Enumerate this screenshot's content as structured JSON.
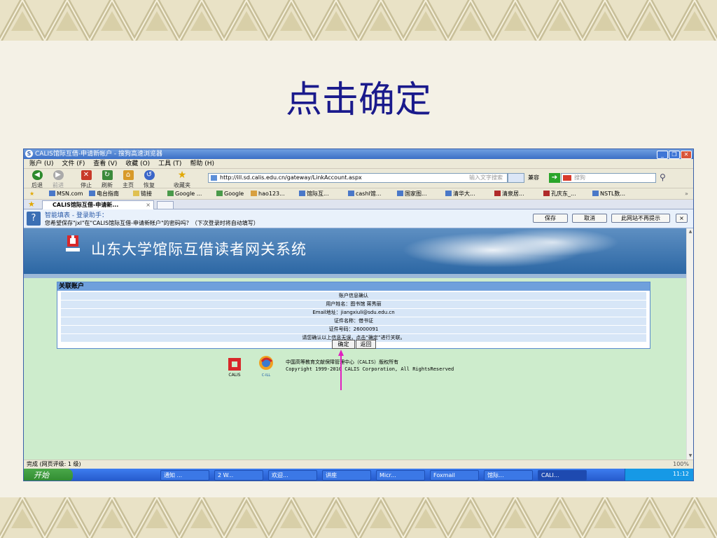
{
  "slide": {
    "title": "点击确定"
  },
  "window": {
    "title": "CALIS馆际互借-申请新帐户 - 搜狗高速浏览器",
    "logo": "S"
  },
  "menu": [
    "账户 (U)",
    "文件 (F)",
    "查看 (V)",
    "收藏 (O)",
    "工具 (T)",
    "帮助 (H)"
  ],
  "toolbar": {
    "back": "后退",
    "forward": "前进",
    "stop": "停止",
    "refresh": "刷新",
    "home": "主页",
    "restore": "恢复",
    "favorites": "收藏夹",
    "address": "http://ill.sd.calis.edu.cn/gateway/LinkAccount.aspx",
    "address_hint": "输入文字搜索",
    "compat": "兼容",
    "search_placeholder": "搜狗"
  },
  "favorites": [
    "MSN.com",
    "电台指南",
    "链接",
    "Google ...",
    "Google",
    "hao123...",
    "馆际互...",
    "cashl馆...",
    "国家图...",
    "清华大...",
    "清泉居...",
    "孔庆东_...",
    "NSTL数..."
  ],
  "tab": {
    "label": "CALIS馆际互借-申请新...",
    "close": "×"
  },
  "password_bar": {
    "title": "智能填表 - 登录助手：",
    "text": "您希望保存\"jxl\"在\"CALIS馆际互借-申请新帐户\"的密码吗？（下次登录时将自动填写）",
    "save": "保存",
    "cancel": "取消",
    "never": "此网站不再提示",
    "close": "×"
  },
  "site": {
    "title": "山东大学馆际互借读者网关系统",
    "logo_text": "CALIS"
  },
  "account": {
    "header": "关联账户",
    "rows": [
      "账户信息确认",
      "用户姓名：图书馆 蒋秀丽",
      "Email地址：jiangxiuli@sdu.edu.cn",
      "证件名称：借书证",
      "证件号码：26000091",
      "请您确认以上信息无误，点击“确定”进行关联。"
    ],
    "confirm": "确定",
    "back": "返回"
  },
  "footer": {
    "line1": "中国高等教育文献保障管理中心（CALIS）版权所有",
    "line2": "Copyright 1999-2010 CALIS Corporation, All RightsReserved",
    "calis_label": "CALIS",
    "cill_label": "C-ILL"
  },
  "status": {
    "text": "完成 (网页评级: 1 级)",
    "right": "100%"
  },
  "taskbar": {
    "start": "开始",
    "tasks": [
      "通知 ...",
      "2 W...",
      "欢迎...",
      "讲座",
      "Micr...",
      "Foxmail",
      "馆际...",
      "CALI..."
    ],
    "clock": "11:12"
  },
  "colors": {
    "accent": "#e020c0",
    "slide_title": "#1a1a8c",
    "content_bg": "#cdeccc"
  }
}
